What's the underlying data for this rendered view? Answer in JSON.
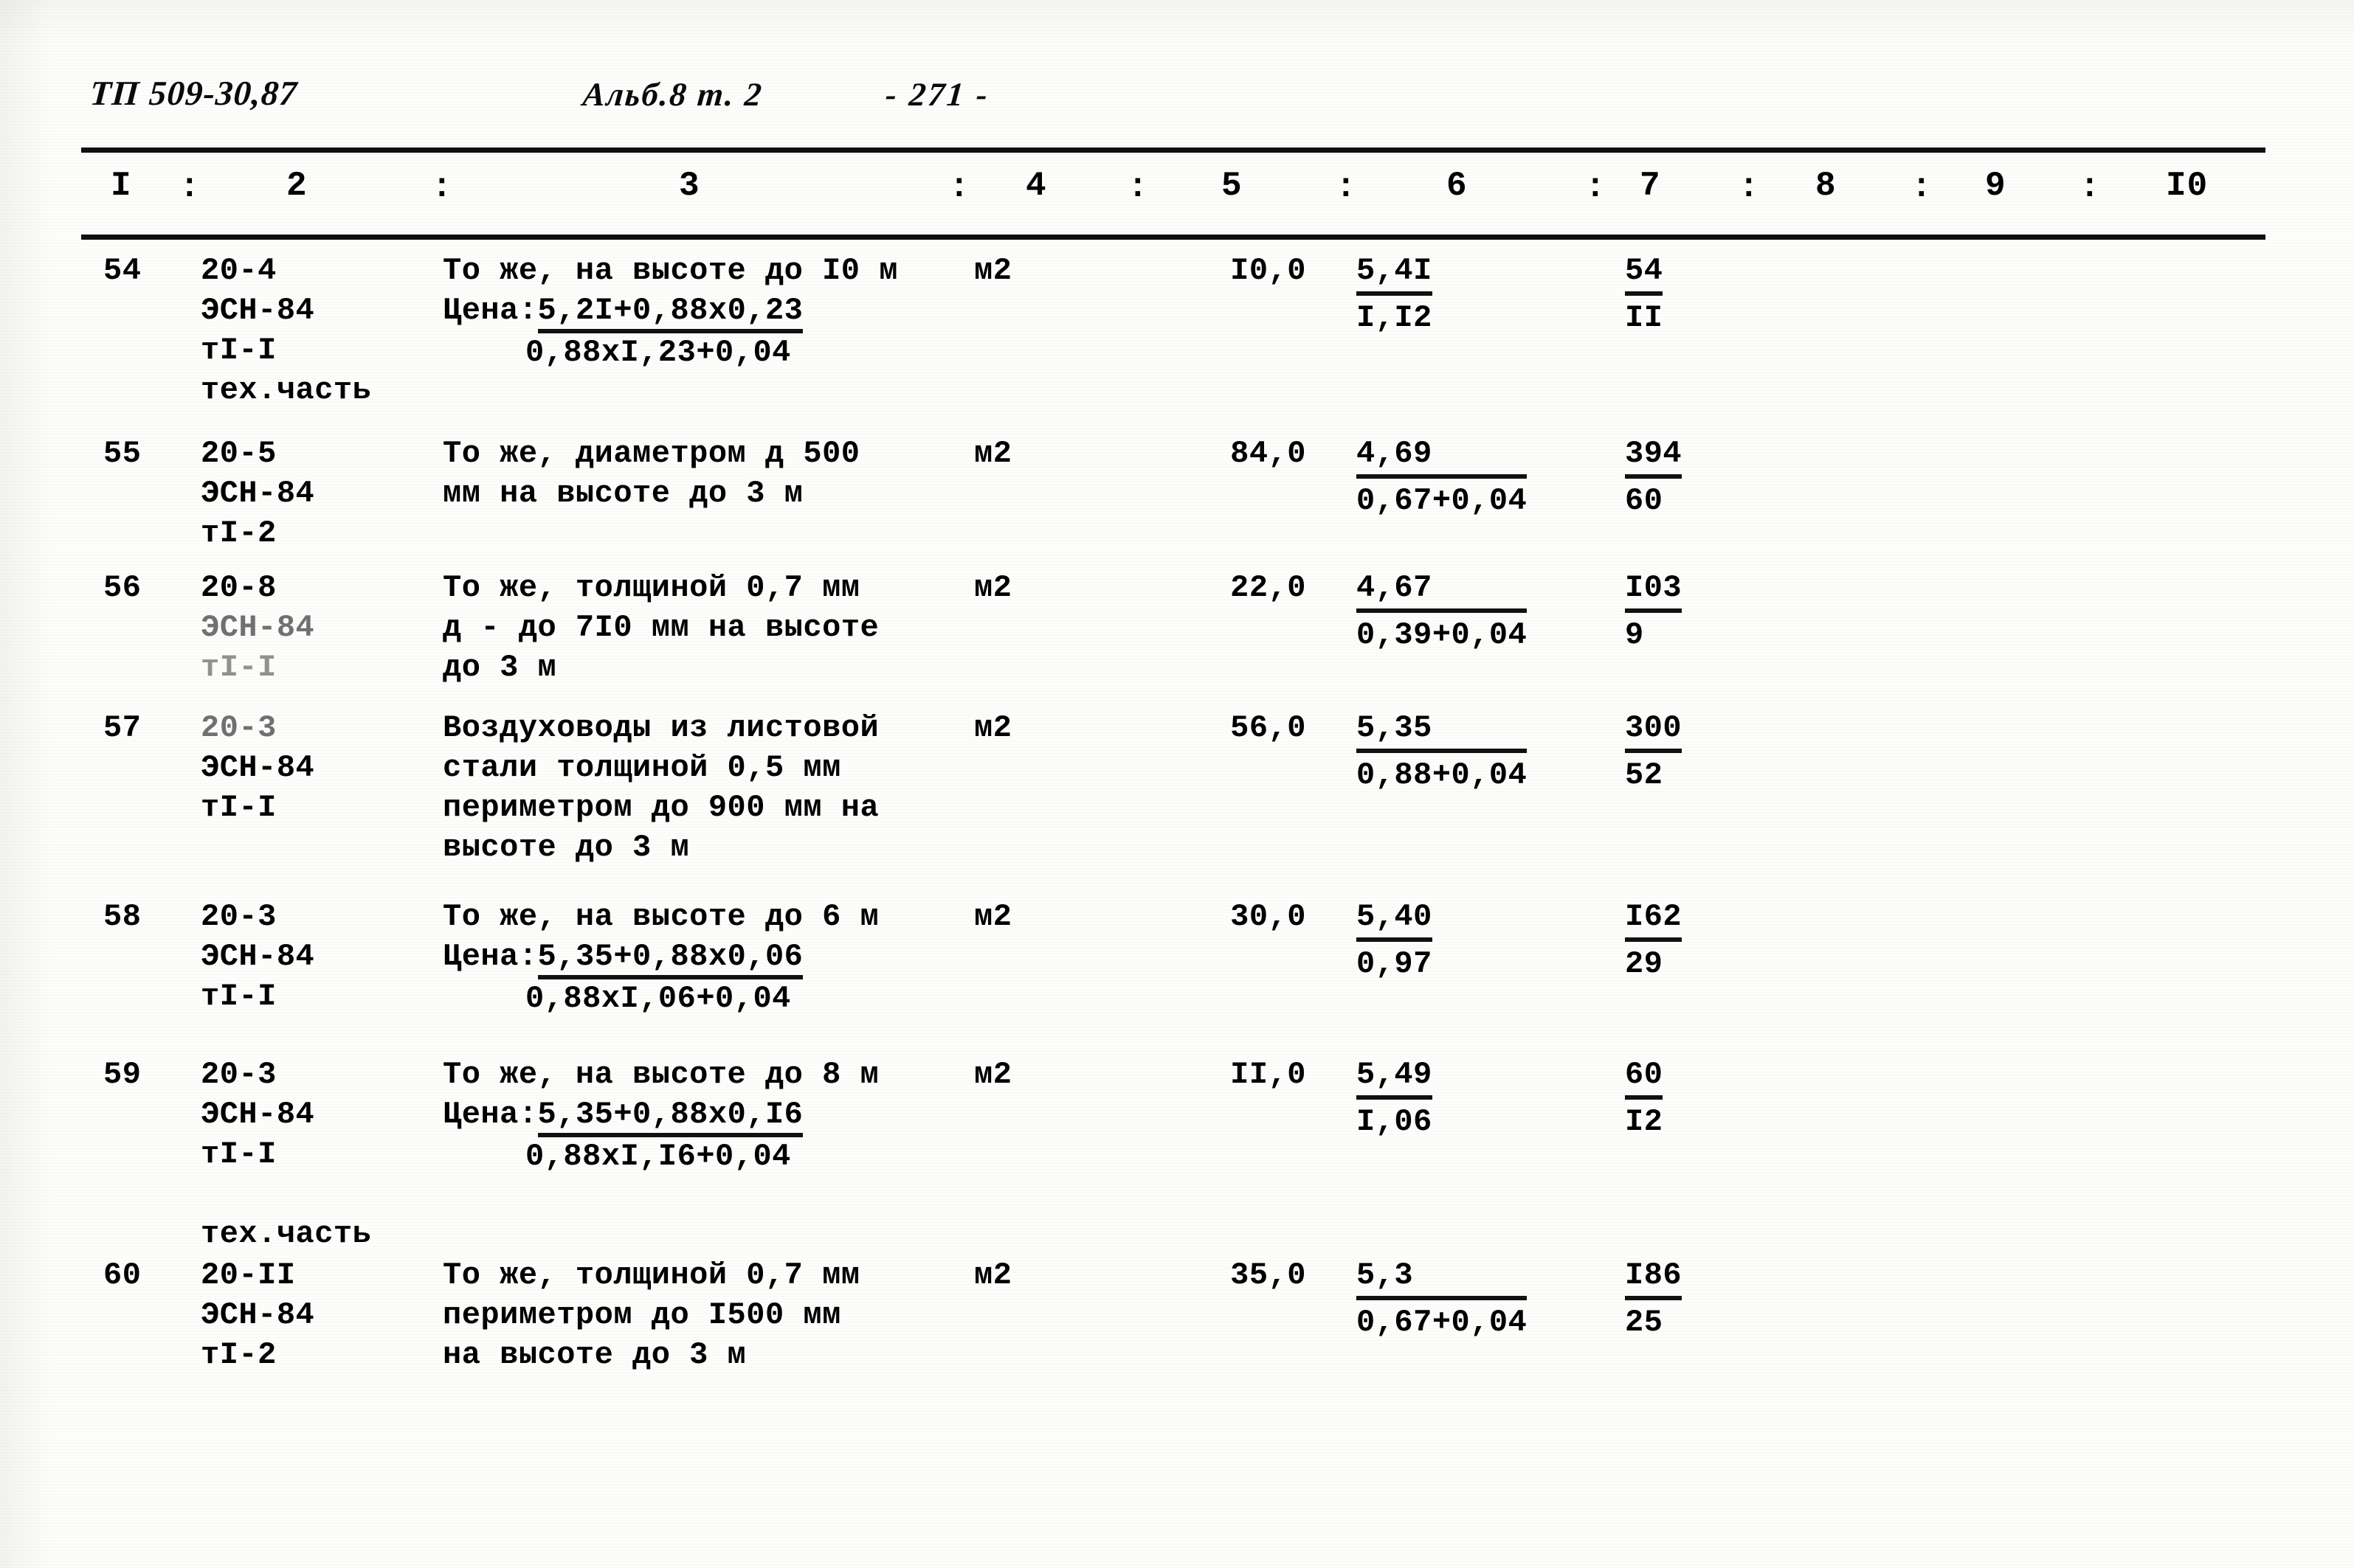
{
  "document": {
    "doc_code": "ТП 509-30,87",
    "album_ref": "Альб.8 т. 2",
    "page_number": "- 271 -"
  },
  "column_numbers": {
    "c1": "I",
    "c2": "2",
    "c3": "3",
    "c4": "4",
    "c5": "5",
    "c6": "6",
    "c7": "7",
    "c8": "8",
    "c9": "9",
    "c10": "I0",
    "separator": ":"
  },
  "rows": [
    {
      "num": "54",
      "code_lines": [
        "20-4",
        "ЭСН-84",
        "тI-I",
        "тех.часть"
      ],
      "desc_line1": "То же, на высоте до I0 м",
      "price_lead": "Цена:",
      "price_num": "5,2I+0,88х0,23",
      "price_den": "0,88хI,23+0,04",
      "unit": "м2",
      "qty": "I0,0",
      "c6_num": "5,4I",
      "c6_den": "I,I2",
      "c7_num": "54",
      "c7_den": "II",
      "c8": "",
      "c9": "",
      "c10": ""
    },
    {
      "num": "55",
      "code_lines": [
        "20-5",
        "ЭСН-84",
        "тI-2"
      ],
      "desc_lines": [
        "То же, диаметром д 500",
        "мм на высоте до 3 м"
      ],
      "unit": "м2",
      "qty": "84,0",
      "c6_num": "4,69",
      "c6_den": "0,67+0,04",
      "c7_num": "394",
      "c7_den": "60",
      "c8": "",
      "c9": "",
      "c10": ""
    },
    {
      "num": "56",
      "code_lines": [
        "20-8",
        "ЭСН-84",
        "тI-I"
      ],
      "desc_lines": [
        "То же, толщиной 0,7 мм",
        "д - до 7I0 мм на высоте",
        "до 3 м"
      ],
      "unit": "м2",
      "qty": "22,0",
      "c6_num": "4,67",
      "c6_den": "0,39+0,04",
      "c7_num": "I03",
      "c7_den": "9",
      "c8": "",
      "c9": "",
      "c10": ""
    },
    {
      "num": "57",
      "code_lines": [
        "20-3",
        "ЭСН-84",
        "тI-I"
      ],
      "desc_lines": [
        "Воздуховоды из листовой",
        "стали толщиной 0,5 мм",
        "периметром до 900 мм на",
        "высоте до 3 м"
      ],
      "unit": "м2",
      "qty": "56,0",
      "c6_num": "5,35",
      "c6_den": "0,88+0,04",
      "c7_num": "300",
      "c7_den": "52",
      "c8": "",
      "c9": "",
      "c10": ""
    },
    {
      "num": "58",
      "code_lines": [
        "20-3",
        "ЭСН-84",
        "тI-I"
      ],
      "desc_line1": "То же, на высоте до 6 м",
      "price_lead": "Цена:",
      "price_num": "5,35+0,88х0,06",
      "price_den": "0,88хI,06+0,04",
      "unit": "м2",
      "qty": "30,0",
      "c6_num": "5,40",
      "c6_den": "0,97",
      "c7_num": "I62",
      "c7_den": "29",
      "c8": "",
      "c9": "",
      "c10": ""
    },
    {
      "num": "59",
      "code_lines": [
        "20-3",
        "ЭСН-84",
        "тI-I",
        "",
        "тех.часть"
      ],
      "desc_line1": "То же, на высоте до 8 м",
      "price_lead": "Цена:",
      "price_num": "5,35+0,88х0,I6",
      "price_den": "0,88хI,I6+0,04",
      "unit": "м2",
      "qty": "II,0",
      "c6_num": "5,49",
      "c6_den": "I,06",
      "c7_num": "60",
      "c7_den": "I2",
      "c8": "",
      "c9": "",
      "c10": ""
    },
    {
      "num": "60",
      "code_lines": [
        "20-II",
        "ЭСН-84",
        "тI-2"
      ],
      "desc_lines": [
        "То же, толщиной 0,7 мм",
        "периметром до I500 мм",
        "на высоте до 3 м"
      ],
      "unit": "м2",
      "qty": "35,0",
      "c6_num": "5,3",
      "c6_den": "0,67+0,04",
      "c7_num": "I86",
      "c7_den": "25",
      "c8": "",
      "c9": "",
      "c10": ""
    }
  ]
}
